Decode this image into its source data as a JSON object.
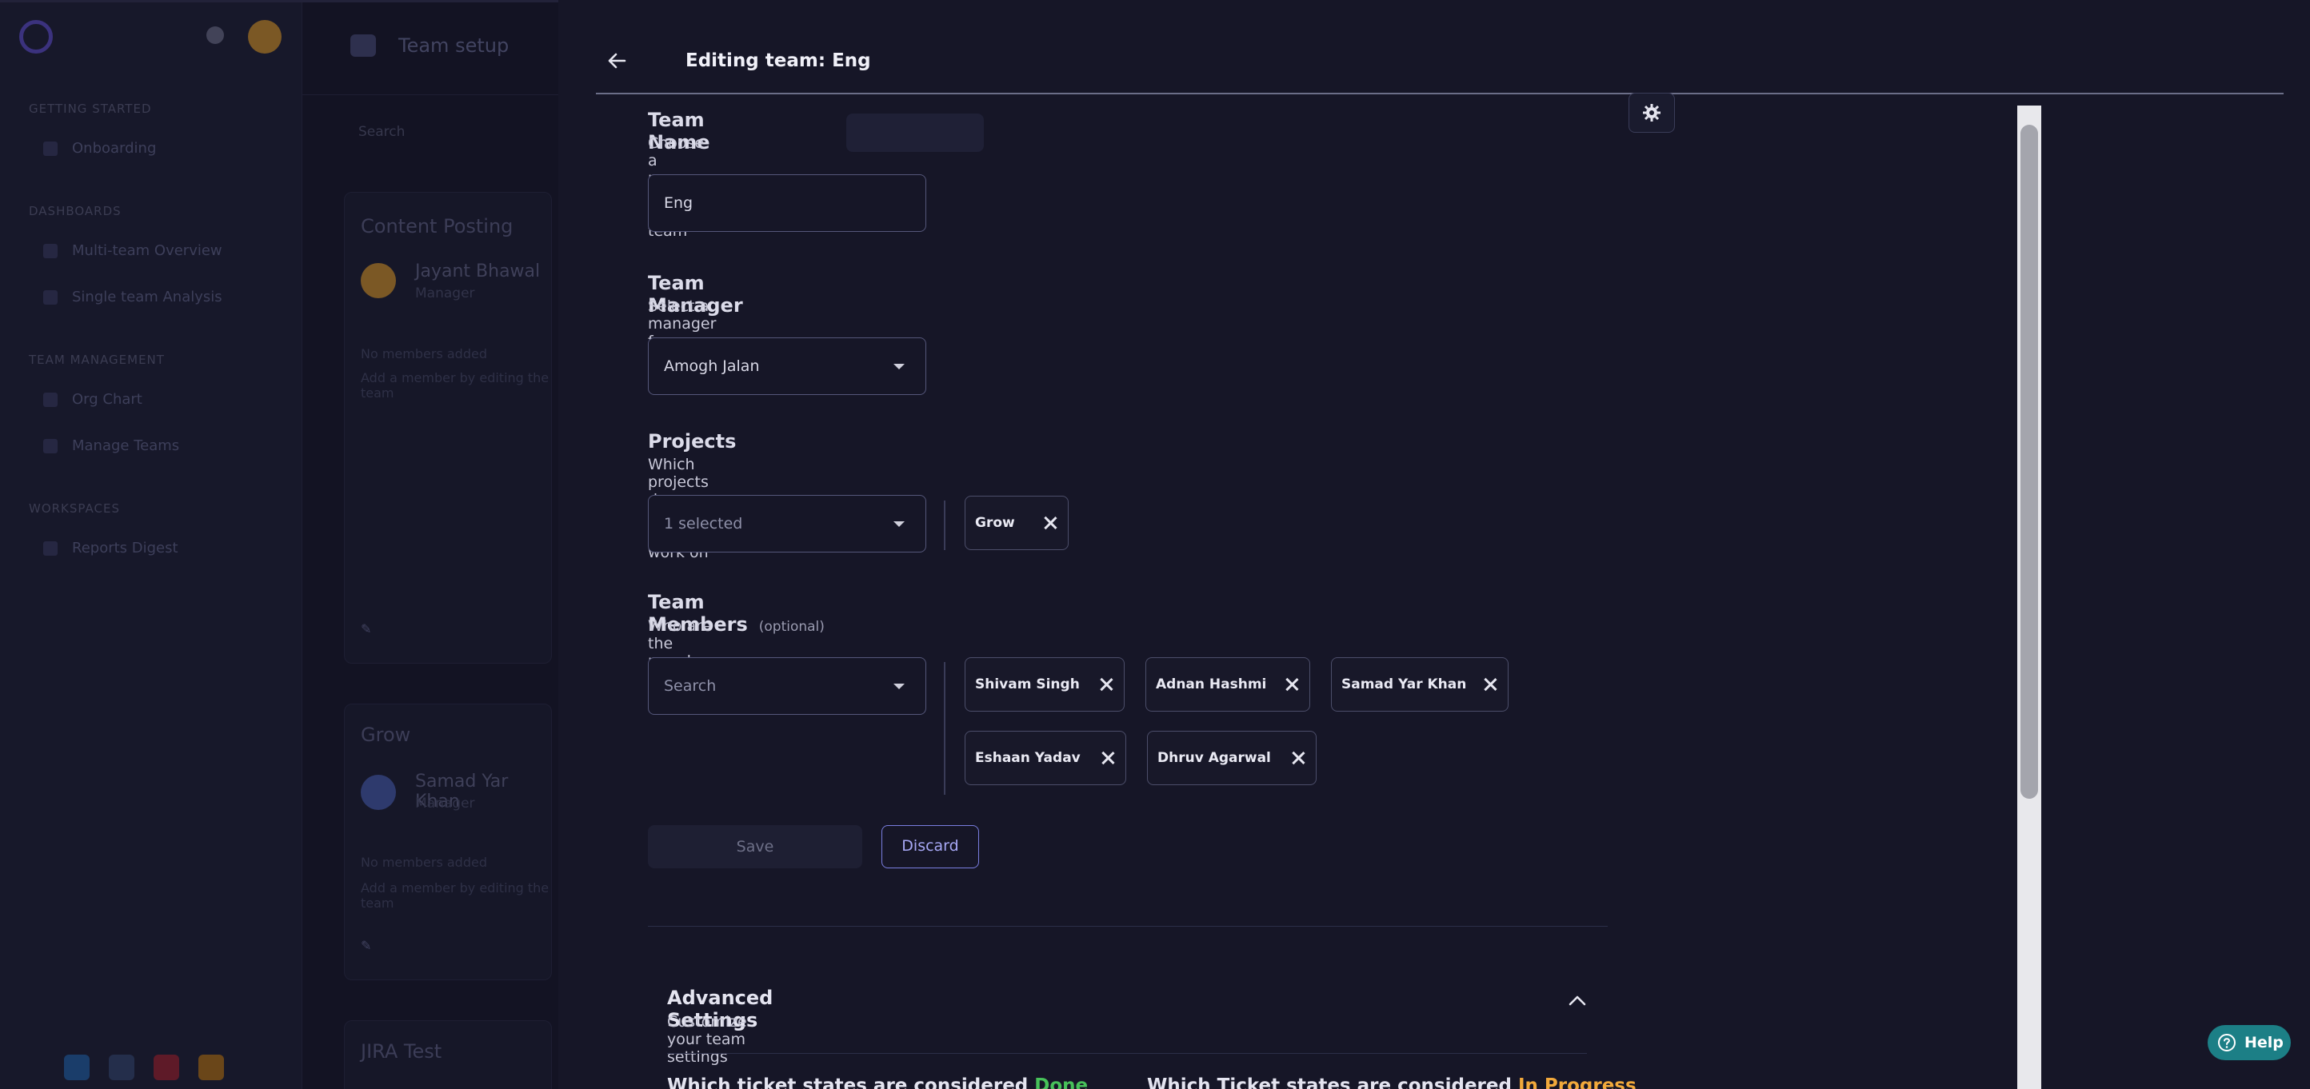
{
  "background": {
    "page_title": "Team setup",
    "sidebar": {
      "sections": [
        {
          "title": "GETTING STARTED",
          "items": [
            "Onboarding"
          ]
        },
        {
          "title": "DASHBOARDS",
          "items": [
            "Multi-team Overview",
            "Single team Analysis"
          ]
        },
        {
          "title": "TEAM MANAGEMENT",
          "items": [
            "Org Chart",
            "Manage Teams"
          ]
        },
        {
          "title": "WORKSPACES",
          "items": [
            "Reports Digest"
          ]
        }
      ]
    },
    "search_placeholder": "Search",
    "cards": [
      {
        "title": "Content Posting",
        "manager": "Jayant Bhawal",
        "role": "Manager",
        "empty": "No members added",
        "hint": "Add a member by editing the team"
      },
      {
        "title": "Grow",
        "manager": "Samad Yar Khan",
        "role": "Manager",
        "empty": "No members added",
        "hint": "Add a member by editing the team"
      },
      {
        "title": "JIRA Test"
      }
    ]
  },
  "drawer": {
    "title": "Editing team: Eng",
    "team_name": {
      "title": "Team Name",
      "description": "Choose a name for your team",
      "value": "Eng"
    },
    "team_manager": {
      "title": "Team Manager",
      "description": "Select a manager for your team",
      "value": "Amogh Jalan"
    },
    "projects": {
      "title": "Projects",
      "description": "Which projects does this team work on",
      "select_value": "1 selected",
      "chips": [
        "Grow"
      ]
    },
    "team_members": {
      "title": "Team Members",
      "optional": "(optional)",
      "description": "Who are the members of this teams",
      "placeholder": "Search",
      "chips": [
        "Shivam Singh",
        "Adnan Hashmi",
        "Samad Yar Khan",
        "Eshaan Yadav",
        "Dhruv Agarwal"
      ]
    },
    "buttons": {
      "save": "Save",
      "discard": "Discard"
    },
    "advanced": {
      "title": "Advanced Settings",
      "description": "Customize your team settings",
      "question_done_prefix": "Which ticket states are considered ",
      "question_done_highlight": "Done",
      "question_progress_prefix": "Which Ticket states are considered ",
      "question_progress_highlight": "In Progress"
    }
  },
  "help_label": "Help",
  "icons": {
    "back": "arrow-left-icon",
    "caret": "chevron-down-icon",
    "remove": "close-icon",
    "collapse": "chevron-up-icon",
    "settings": "gear-icon",
    "help": "question-circle-icon"
  },
  "colors": {
    "background": "#161627",
    "accent": "#7a7ee0",
    "done": "#47c25a",
    "in_progress": "#f2a93b",
    "help": "#1c7f86"
  }
}
